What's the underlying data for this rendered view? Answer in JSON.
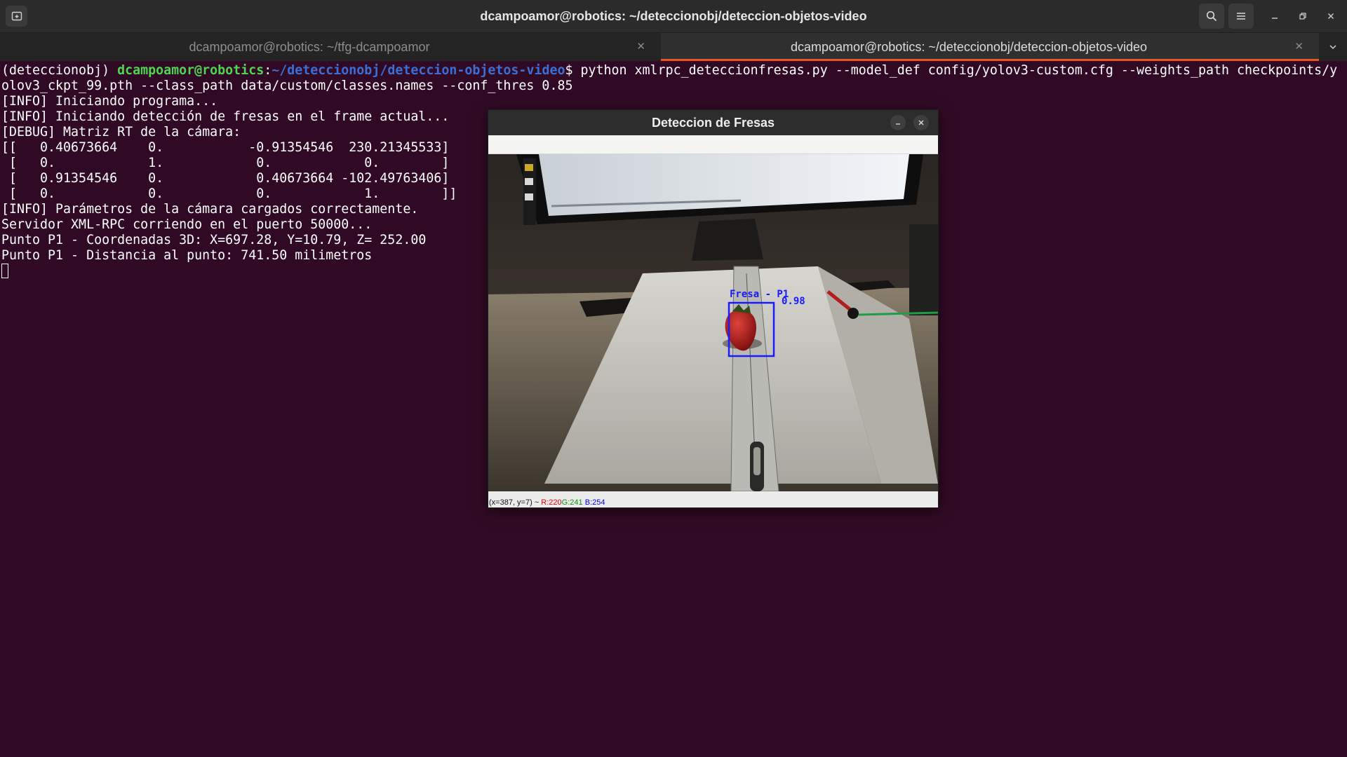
{
  "header": {
    "title": "dcampoamor@robotics: ~/deteccionobj/deteccion-objetos-video"
  },
  "tabs": [
    {
      "label": "dcampoamor@robotics: ~/tfg-dcampoamor",
      "active": false
    },
    {
      "label": "dcampoamor@robotics: ~/deteccionobj/deteccion-objetos-video",
      "active": true
    }
  ],
  "terminal": {
    "prompt_env": "(deteccionobj) ",
    "prompt_user": "dcampoamor@robotics",
    "prompt_sep": ":",
    "prompt_path": "~/deteccionobj/deteccion-objetos-video",
    "prompt_symbol": "$ ",
    "command": "python xmlrpc_deteccionfresas.py --model_def config/yolov3-custom.cfg --weights_path checkpoints/y",
    "lines": [
      "olov3_ckpt_99.pth --class_path data/custom/classes.names --conf_thres 0.85",
      "[INFO] Iniciando programa...",
      "[INFO] Iniciando detección de fresas en el frame actual...",
      "[DEBUG] Matriz RT de la cámara:",
      "[[   0.40673664    0.           -0.91354546  230.21345533]",
      " [   0.            1.            0.            0.        ]",
      " [   0.91354546    0.            0.40673664 -102.49763406]",
      " [   0.            0.            0.            1.        ]]",
      "[INFO] Parámetros de la cámara cargados correctamente.",
      "Servidor XML-RPC corriendo en el puerto 50000...",
      "Punto P1 - Coordenadas 3D: X=697.28, Y=10.79, Z= 252.00",
      "Punto P1 - Distancia al punto: 741.50 milimetros"
    ]
  },
  "cv_window": {
    "title": "Deteccion de Fresas",
    "detection_label": "Fresa - P1",
    "detection_confidence": "0.98",
    "status": {
      "coords": "(x=387, y=7) ~ ",
      "r": "R:220",
      "g": "G:241",
      "b": "B:254"
    }
  },
  "colors": {
    "terminal_bg": "#300a24",
    "prompt_user": "#4fd64f",
    "prompt_path": "#3b6fd6",
    "tab_indicator": "#e95420",
    "bbox": "#1a1aff"
  }
}
